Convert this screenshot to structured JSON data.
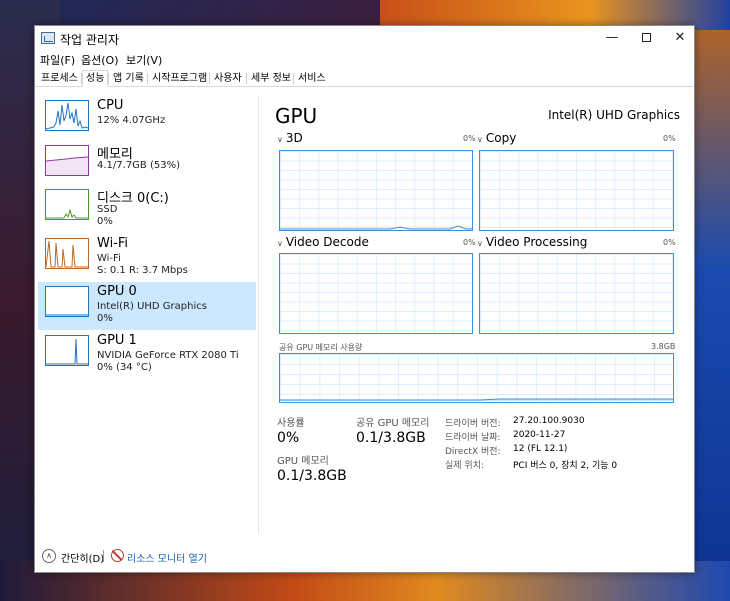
{
  "window": {
    "title": "작업 관리자",
    "controls": {
      "minimize": "—",
      "close": "✕"
    }
  },
  "menu": [
    "파일(F)",
    "옵션(O)",
    "보기(V)"
  ],
  "tabs": [
    "프로세스",
    "성능",
    "앱 기록",
    "시작프로그램",
    "사용자",
    "세부 정보",
    "서비스"
  ],
  "active_tab": "성능",
  "sidebar": {
    "items": [
      {
        "title": "CPU",
        "line1": "12%  4.07GHz",
        "line2": "",
        "color": "#1f74c4"
      },
      {
        "title": "메모리",
        "line1": "4.1/7.7GB (53%)",
        "line2": "",
        "color": "#8b3aa8"
      },
      {
        "title": "디스크 0(C:)",
        "line1": "SSD",
        "line2": "0%",
        "color": "#4f9a2a"
      },
      {
        "title": "Wi-Fi",
        "line1": "Wi-Fi",
        "line2": "S: 0.1  R: 3.7 Mbps",
        "color": "#b86a2a"
      },
      {
        "title": "GPU 0",
        "line1": "Intel(R) UHD Graphics",
        "line2": "0%",
        "color": "#1f74c4"
      },
      {
        "title": "GPU 1",
        "line1": "NVIDIA GeForce RTX 2080 Ti",
        "line2": "0% (34 °C)",
        "color": "#1f74c4"
      }
    ],
    "selected_index": 4
  },
  "main": {
    "title": "GPU",
    "model": "Intel(R) UHD Graphics",
    "graphs": [
      {
        "label": "3D",
        "pct": "0%"
      },
      {
        "label": "Copy",
        "pct": "0%"
      },
      {
        "label": "Video Decode",
        "pct": "0%"
      },
      {
        "label": "Video Processing",
        "pct": "0%"
      }
    ],
    "shared_mem_graph": {
      "label": "공유 GPU 메모리 사용량",
      "max": "3.8GB"
    },
    "stats": {
      "utilization_label": "사용률",
      "utilization_value": "0%",
      "shared_mem_label": "공유 GPU 메모리",
      "shared_mem_value": "0.1/3.8GB",
      "gpu_mem_label": "GPU 메모리",
      "gpu_mem_value": "0.1/3.8GB"
    },
    "info": [
      {
        "key": "드라이버 버전:",
        "value": "27.20.100.9030"
      },
      {
        "key": "드라이버 날짜:",
        "value": "2020-11-27"
      },
      {
        "key": "DirectX 버전:",
        "value": "12 (FL 12.1)"
      },
      {
        "key": "실제 위치:",
        "value": "PCI 버스 0, 장치 2, 기능 0"
      }
    ]
  },
  "bottom": {
    "fewer_details": "간단히(D)",
    "resource_monitor": "리소스 모니터 열기"
  }
}
